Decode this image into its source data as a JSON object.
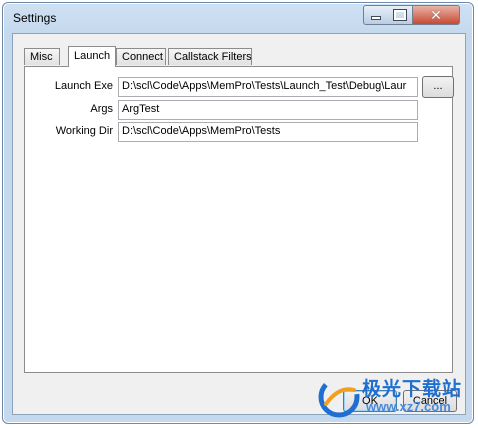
{
  "window": {
    "title": "Settings",
    "controls": {
      "minimize": "minimize",
      "maximize": "maximize",
      "close": "✕"
    }
  },
  "tabs": [
    {
      "label": "Misc",
      "active": false
    },
    {
      "label": "Launch",
      "active": true
    },
    {
      "label": "Connect",
      "active": false
    },
    {
      "label": "Callstack Filters",
      "active": false
    }
  ],
  "launch": {
    "launch_exe_label": "Launch Exe",
    "launch_exe_value": "D:\\scl\\Code\\Apps\\MemPro\\Tests\\Launch_Test\\Debug\\Laur",
    "browse_label": "...",
    "args_label": "Args",
    "args_value": "ArgTest",
    "working_dir_label": "Working Dir",
    "working_dir_value": "D:\\scl\\Code\\Apps\\MemPro\\Tests"
  },
  "footer": {
    "ok_label": "OK",
    "cancel_label": "Cancel"
  },
  "watermark": {
    "line1": "极光下载站",
    "line2": "www.xz7.com"
  },
  "colors": {
    "frame": "#c5d9ee",
    "close_button": "#c74a33",
    "watermark": "#1f6fd1"
  }
}
